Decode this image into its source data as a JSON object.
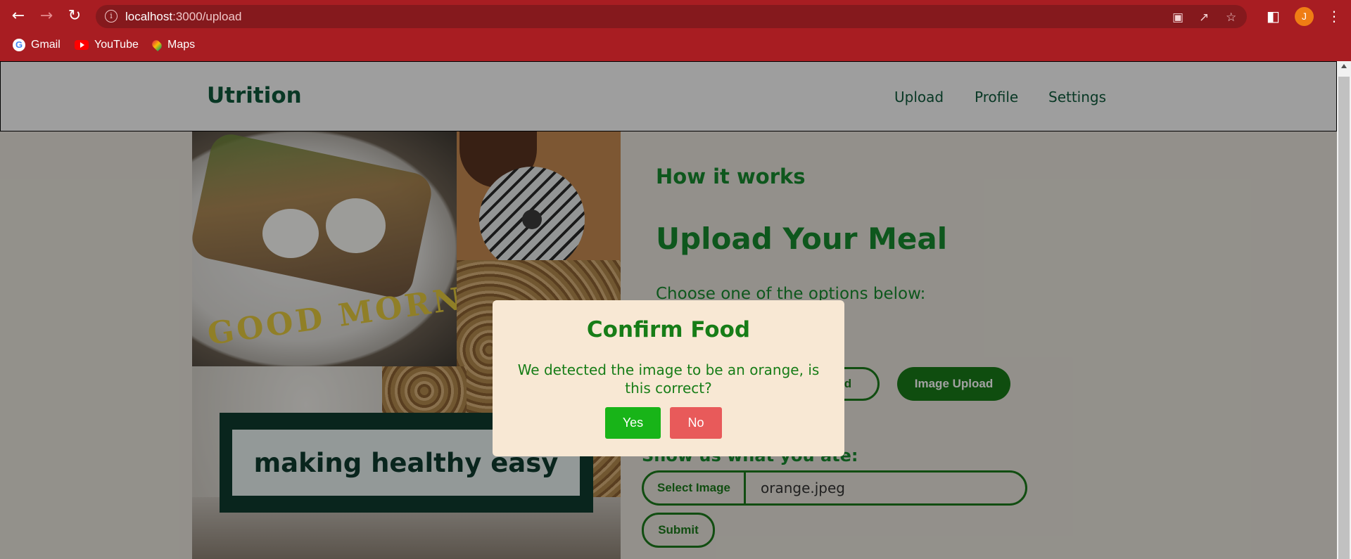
{
  "browser": {
    "url_host": "localhost",
    "url_path": ":3000/upload",
    "avatar_initial": "J",
    "bookmarks": [
      {
        "label": "Gmail",
        "icon": "google-icon"
      },
      {
        "label": "YouTube",
        "icon": "youtube-icon"
      },
      {
        "label": "Maps",
        "icon": "maps-icon"
      }
    ],
    "theme_color": "#a81d22"
  },
  "site": {
    "logo": "Utrition",
    "nav": [
      "Upload",
      "Profile",
      "Settings"
    ],
    "tagline": "making healthy easy"
  },
  "main": {
    "how_heading": "How it works",
    "upload_heading": "Upload Your Meal",
    "choose_text": "Choose one of the options below:",
    "options": [
      "Barcode Upload",
      "Image Upload"
    ],
    "show_label": "Show us what you ate:",
    "select_image_label": "Select Image",
    "file_name": "orange.jpeg",
    "submit_label": "Submit"
  },
  "modal": {
    "title": "Confirm Food",
    "message": "We detected the image to be an orange, is this correct?",
    "yes_label": "Yes",
    "no_label": "No",
    "yes_color": "#18b418",
    "no_color": "#e85a5a"
  }
}
